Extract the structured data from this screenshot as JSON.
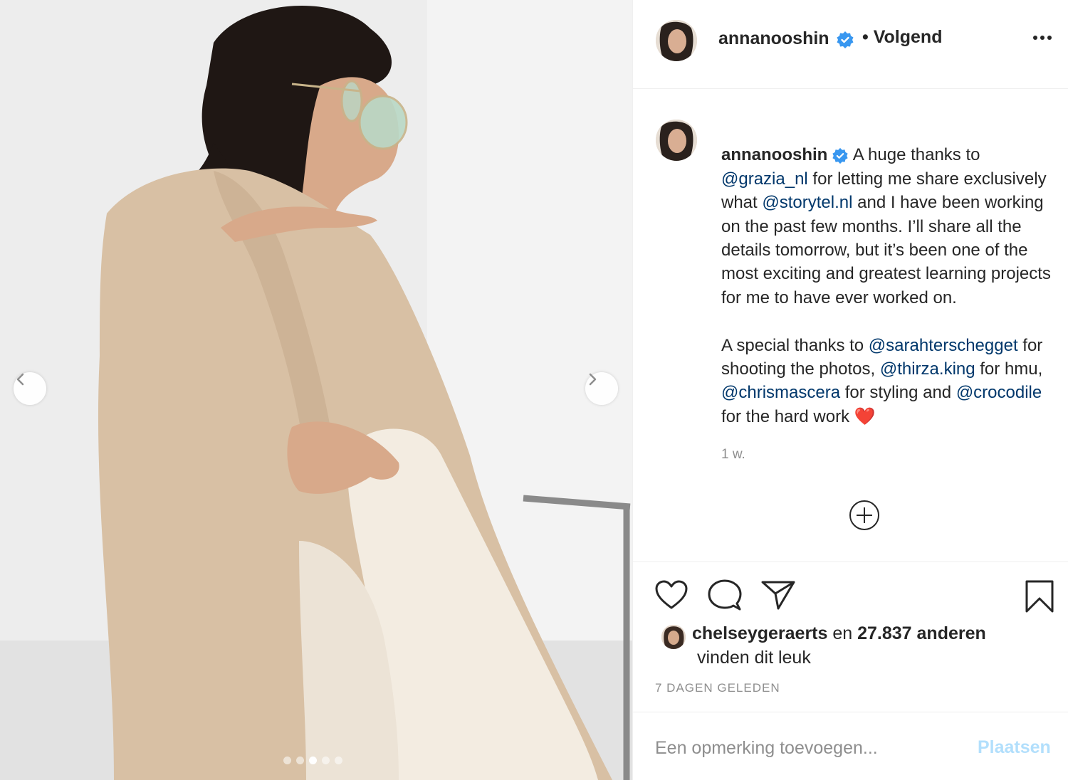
{
  "post": {
    "username": "annanooshin",
    "follow_separator": "•",
    "follow_status": "Volgend",
    "verified_icon": "verified-badge-icon",
    "more_icon": "more-options-icon",
    "carousel": {
      "slide_count": 5,
      "active_index": 2,
      "prev_icon": "chevron-left-icon",
      "next_icon": "chevron-right-icon"
    }
  },
  "caption": {
    "username": "annanooshin",
    "parts": [
      {
        "text": " A huge thanks to "
      },
      {
        "text": "@grazia_nl",
        "mention": true
      },
      {
        "text": " for letting me share exclusively what "
      },
      {
        "text": "@storytel.nl",
        "mention": true
      },
      {
        "text": " and I have been working on the past few months. I’ll share all the details tomorrow, but it’s been one of the most exciting and greatest learning projects for me to have ever worked on.\n\nA special thanks to "
      },
      {
        "text": "@sarahterschegget",
        "mention": true
      },
      {
        "text": " for shooting the photos, "
      },
      {
        "text": "@thirza.king",
        "mention": true
      },
      {
        "text": " for hmu, "
      },
      {
        "text": "@chrismascera",
        "mention": true
      },
      {
        "text": " for styling and "
      },
      {
        "text": "@crocodile",
        "mention": true
      },
      {
        "text": " for the hard work ❤️"
      }
    ],
    "time": "1 w.",
    "load_more_icon": "plus-circle-icon"
  },
  "actions": {
    "like_icon": "heart-icon",
    "comment_icon": "comment-icon",
    "share_icon": "send-icon",
    "save_icon": "bookmark-icon"
  },
  "likes": {
    "liker": "chelseygeraerts",
    "connector": " en ",
    "others": "27.837 anderen",
    "suffix": "vinden dit leuk"
  },
  "date": "7 DAGEN GELEDEN",
  "comment_box": {
    "placeholder": "Een opmerking toevoegen...",
    "post_label": "Plaatsen"
  },
  "colors": {
    "mention": "#00376b",
    "verified": "#3897f0",
    "post_button_disabled": "#b2dffc",
    "heart": "#ed1c24"
  }
}
